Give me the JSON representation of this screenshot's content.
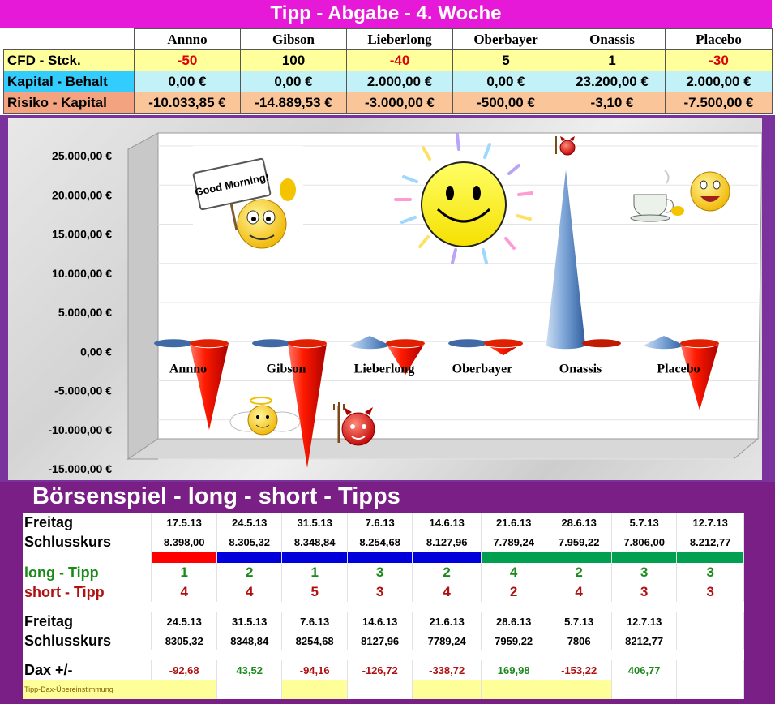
{
  "header": {
    "title": "Tipp - Abgabe   -   4. Woche"
  },
  "players": [
    "Annno",
    "Gibson",
    "Lieberlong",
    "Oberbayer",
    "Onassis",
    "Placebo"
  ],
  "rows": [
    {
      "label": "CFD - Stck.",
      "values": [
        "-50",
        "100",
        "-40",
        "5",
        "1",
        "-30"
      ]
    },
    {
      "label": "Kapital - Behalt",
      "values": [
        "0,00 €",
        "0,00 €",
        "2.000,00 €",
        "0,00 €",
        "23.200,00 €",
        "2.000,00 €"
      ]
    },
    {
      "label": "Risiko - Kapital",
      "values": [
        "-10.033,85 €",
        "-14.889,53 €",
        "-3.000,00 €",
        "-500,00 €",
        "-3,10 €",
        "-7.500,00 €"
      ]
    }
  ],
  "colors": {
    "title_bg": "#e619d9",
    "frame": "#7a339c",
    "bottom_frame": "#7a1f86",
    "positive": "#3a6fb8",
    "negative": "#d80000"
  },
  "chart_data": {
    "type": "bar",
    "shape": "cone",
    "categories": [
      "Annno",
      "Gibson",
      "Lieberlong",
      "Oberbayer",
      "Onassis",
      "Placebo"
    ],
    "series": [
      {
        "values": [
          0,
          0,
          2000,
          0,
          23200,
          2000
        ]
      },
      {
        "values": [
          -10033.85,
          -14889.53,
          -3000,
          -500,
          -3.1,
          -7500
        ]
      }
    ],
    "yticks": [
      "25.000,00 €",
      "20.000,00 €",
      "15.000,00 €",
      "10.000,00 €",
      "5.000,00 €",
      "0,00 €",
      "-5.000,00 €",
      "-10.000,00 €",
      "-15.000,00 €"
    ],
    "ylim": [
      -15000,
      25000
    ],
    "grid": true,
    "legend": "none"
  },
  "stickers": {
    "good_morning": "Good Morning!"
  },
  "bottom": {
    "title": "Börsenspiel  -  long - short  -  Tipps",
    "freitag_label": "Freitag",
    "schluss_label": "Schlusskurs",
    "dates1": [
      "17.5.13",
      "24.5.13",
      "31.5.13",
      "7.6.13",
      "14.6.13",
      "21.6.13",
      "28.6.13",
      "5.7.13",
      "12.7.13"
    ],
    "kurse1": [
      "8.398,00",
      "8.305,32",
      "8.348,84",
      "8.254,68",
      "8.127,96",
      "7.789,24",
      "7.959,22",
      "7.806,00",
      "8.212,77"
    ],
    "long_label": "long - Tipp",
    "long": [
      "1",
      "2",
      "1",
      "3",
      "2",
      "4",
      "2",
      "3",
      "3"
    ],
    "short_label": "short - Tipp",
    "short": [
      "4",
      "4",
      "5",
      "3",
      "4",
      "2",
      "4",
      "3",
      "3"
    ],
    "dates2": [
      "24.5.13",
      "31.5.13",
      "7.6.13",
      "14.6.13",
      "21.6.13",
      "28.6.13",
      "5.7.13",
      "12.7.13"
    ],
    "kurse2": [
      "8305,32",
      "8348,84",
      "8254,68",
      "8127,96",
      "7789,24",
      "7959,22",
      "7806",
      "8212,77"
    ],
    "dax_label": "Dax +/-",
    "dax": [
      "-92,68",
      "43,52",
      "-94,16",
      "-126,72",
      "-338,72",
      "169,98",
      "-153,22",
      "406,77"
    ],
    "footer": "Tipp-Dax-Übereinstimmung"
  }
}
